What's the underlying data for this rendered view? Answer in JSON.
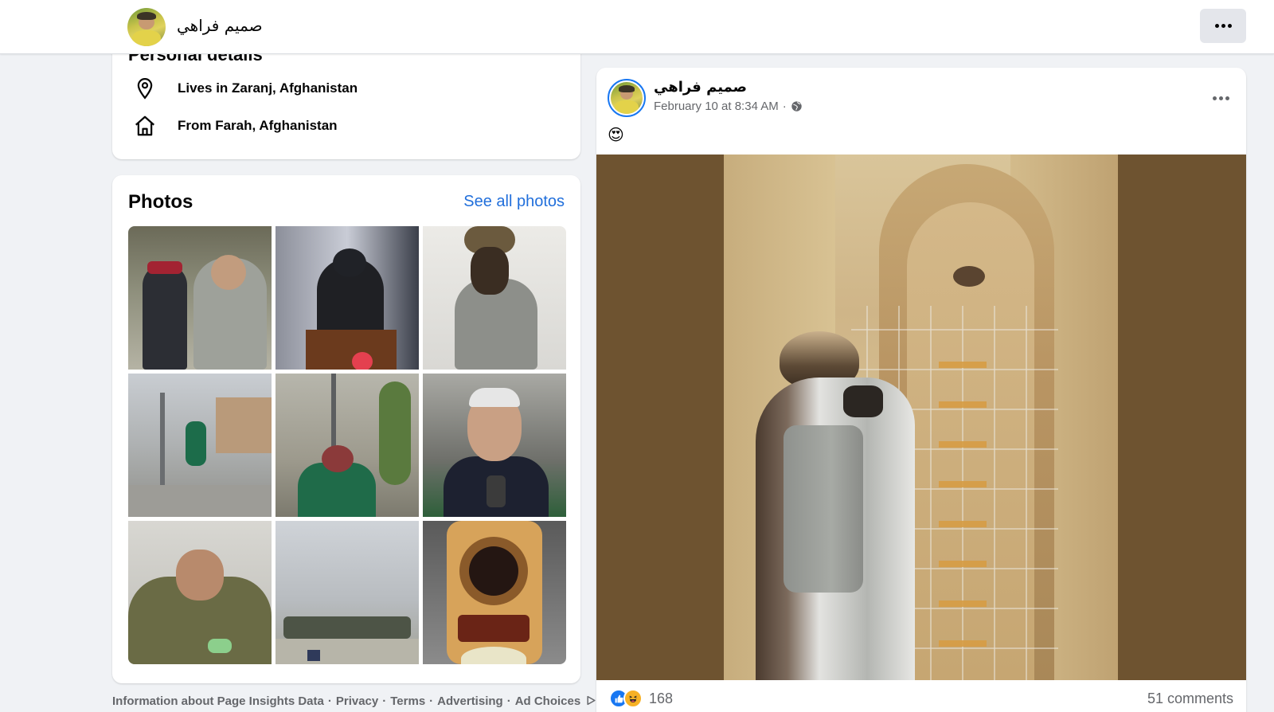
{
  "topbar": {
    "profile_name": "صميم فراهي",
    "more_icon": "more-horizontal-icon"
  },
  "personal_details": {
    "heading": "Personal details",
    "items": [
      {
        "icon": "location-pin-icon",
        "text": "Lives in Zaranj, Afghanistan"
      },
      {
        "icon": "home-icon",
        "text": "From Farah, Afghanistan"
      }
    ]
  },
  "photos": {
    "heading": "Photos",
    "see_all": "See all photos",
    "tile_count": 9
  },
  "footer": {
    "links": [
      "Information about Page Insights Data",
      "Privacy",
      "Terms",
      "Advertising",
      "Ad Choices"
    ]
  },
  "post": {
    "author": "صميم فراهي",
    "timestamp": "February 10 at 8:34 AM",
    "separator": "·",
    "audience_icon": "globe-icon",
    "text": "😍",
    "reaction_count": "168",
    "comments": "51 comments"
  },
  "colors": {
    "link_blue": "#216fdb",
    "like_blue": "#1877f2",
    "background": "#f0f2f5",
    "post_image_bg": "#6e5330"
  }
}
